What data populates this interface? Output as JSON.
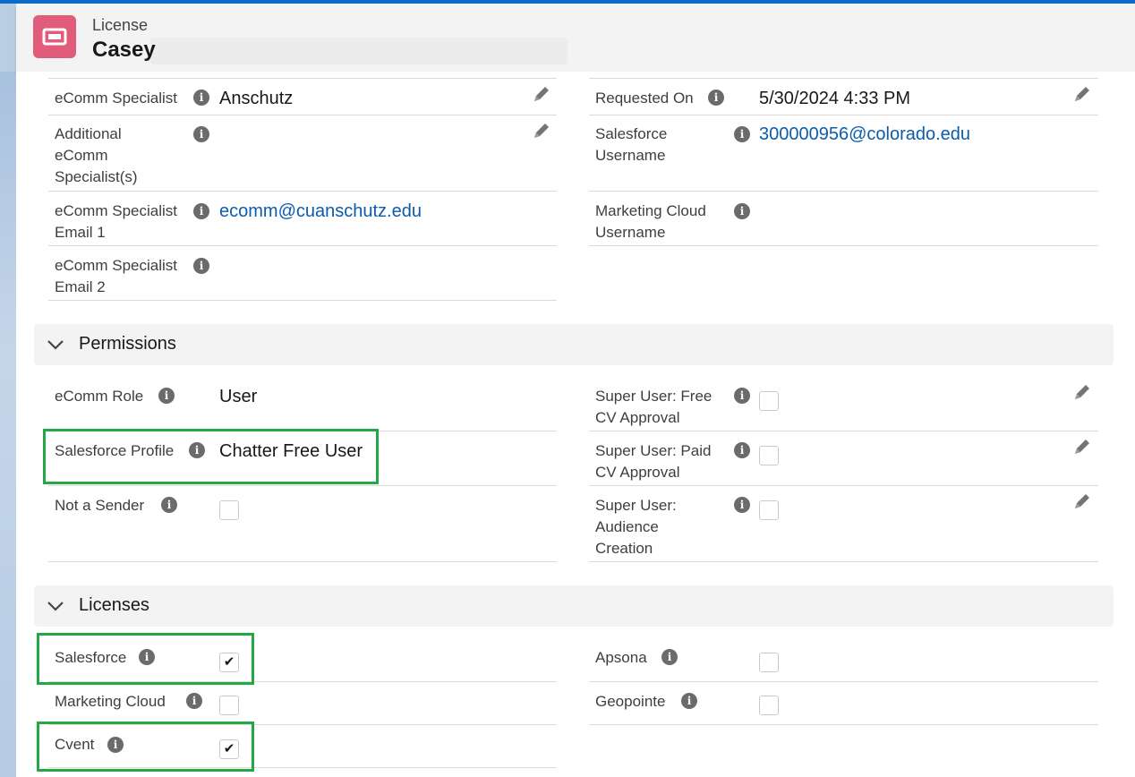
{
  "header": {
    "object_label": "License",
    "record_name": "Casey"
  },
  "contact_fields": {
    "ecomm_specialist": {
      "label": "eComm Specialist",
      "value": "Anschutz"
    },
    "additional_ecomm": {
      "label_lines": [
        "Additional",
        "eComm",
        "Specialist(s)"
      ],
      "value": ""
    },
    "ecomm_email1": {
      "label_lines": [
        "eComm Specialist",
        "Email 1"
      ],
      "value": "ecomm@cuanschutz.edu"
    },
    "ecomm_email2": {
      "label_lines": [
        "eComm Specialist",
        "Email 2"
      ],
      "value": ""
    },
    "requested_on": {
      "label": "Requested On",
      "value": "5/30/2024 4:33 PM"
    },
    "sf_username": {
      "label_lines": [
        "Salesforce",
        "Username"
      ],
      "value": "300000956@colorado.edu"
    },
    "mc_username": {
      "label_lines": [
        "Marketing Cloud",
        "Username"
      ],
      "value": ""
    }
  },
  "permissions": {
    "title": "Permissions",
    "ecomm_role": {
      "label": "eComm Role",
      "value": "User"
    },
    "sf_profile": {
      "label": "Salesforce Profile",
      "value": "Chatter Free User"
    },
    "not_sender": {
      "label": "Not a Sender",
      "checked": false
    },
    "su_free": {
      "label_lines": [
        "Super User: Free",
        "CV Approval"
      ],
      "checked": false
    },
    "su_paid": {
      "label_lines": [
        "Super User: Paid",
        "CV Approval"
      ],
      "checked": false
    },
    "su_audience": {
      "label_lines": [
        "Super User:",
        "Audience",
        "Creation"
      ],
      "checked": false
    }
  },
  "licenses": {
    "title": "Licenses",
    "salesforce": {
      "label": "Salesforce",
      "checked": true,
      "mark": "✔"
    },
    "marketing_cloud": {
      "label": "Marketing Cloud",
      "checked": false,
      "mark": ""
    },
    "cvent": {
      "label": "Cvent",
      "checked": true,
      "mark": "✔"
    },
    "apsona": {
      "label": "Apsona",
      "checked": false,
      "mark": ""
    },
    "geopointe": {
      "label": "Geopointe",
      "checked": false,
      "mark": ""
    }
  },
  "icons": {
    "info": "i",
    "highlight_color": "#22a845",
    "brand_color": "#e05c7a",
    "link_color": "#0b5cab"
  }
}
